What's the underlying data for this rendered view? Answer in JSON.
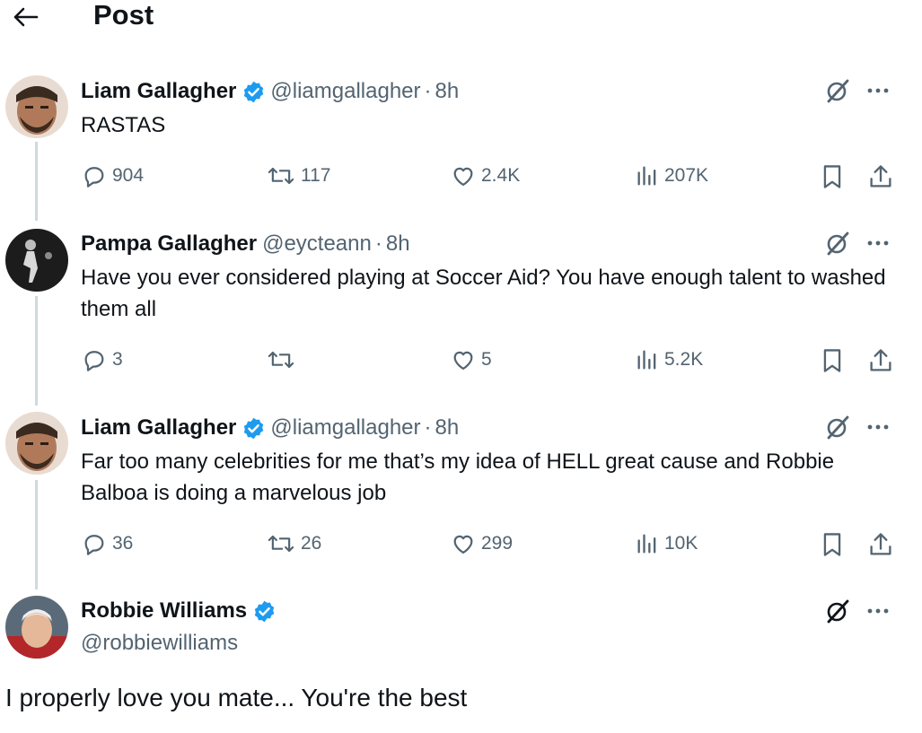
{
  "header": {
    "title": "Post",
    "back_icon": "arrow-left-icon"
  },
  "tweets": [
    {
      "name": "Liam Gallagher",
      "verified": true,
      "handle": "@liamgallagher",
      "time": "8h",
      "text": "RASTAS",
      "replies": "904",
      "reposts": "117",
      "likes": "2.4K",
      "views": "207K"
    },
    {
      "name": "Pampa Gallagher",
      "verified": false,
      "handle": "@eycteann",
      "time": "8h",
      "text": "Have you ever considered playing at Soccer Aid? You have enough talent to washed them all",
      "replies": "3",
      "reposts": "",
      "likes": "5",
      "views": "5.2K"
    },
    {
      "name": "Liam Gallagher",
      "verified": true,
      "handle": "@liamgallagher",
      "time": "8h",
      "text": "Far too many celebrities for me that’s my idea of HELL great cause and Robbie Balboa is doing a marvelous job",
      "replies": "36",
      "reposts": "26",
      "likes": "299",
      "views": "10K"
    }
  ],
  "focused": {
    "name": "Robbie Williams",
    "verified": true,
    "handle": "@robbiewilliams",
    "text": "I properly love you mate... You're the best"
  },
  "colors": {
    "verified_blue": "#1d9bf0",
    "text": "#0f1419",
    "muted": "#536471",
    "thread_line": "#cfd9de"
  }
}
